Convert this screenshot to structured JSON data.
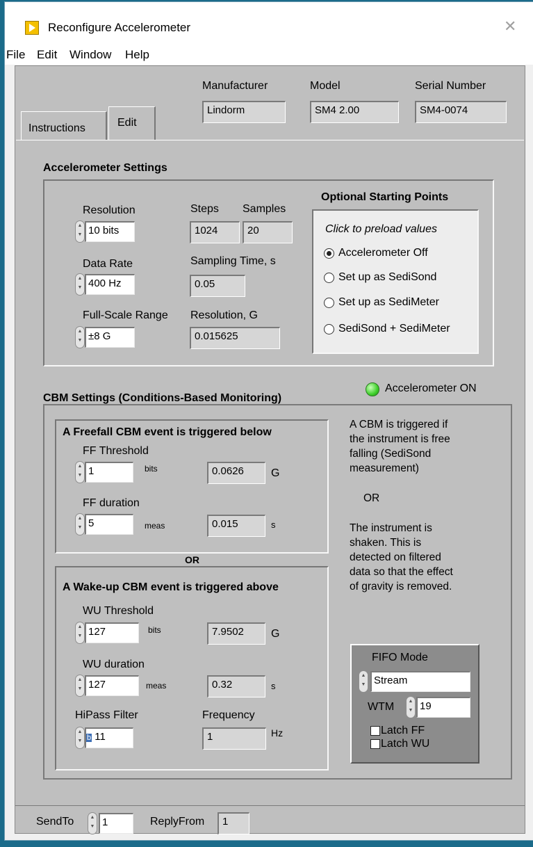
{
  "window": {
    "title": "Reconfigure Accelerometer",
    "close_glyph": "✕"
  },
  "menu": [
    "File",
    "Edit",
    "Window",
    "Help"
  ],
  "header": {
    "manufacturer_label": "Manufacturer",
    "manufacturer_value": "Lindorm",
    "model_label": "Model",
    "model_value": "SM4 2.00",
    "serial_label": "Serial Number",
    "serial_value": "SM4-0074"
  },
  "tabs": [
    {
      "label": "Instructions",
      "selected": false
    },
    {
      "label": "Edit",
      "selected": true
    }
  ],
  "accel": {
    "heading": "Accelerometer Settings",
    "resolution_label": "Resolution",
    "resolution_value": "10 bits",
    "steps_label": "Steps",
    "steps_value": "1024",
    "samples_label": "Samples",
    "samples_value": "20",
    "data_rate_label": "Data Rate",
    "data_rate_value": "400 Hz",
    "sampling_time_label": "Sampling Time, s",
    "sampling_time_value": "0.05",
    "fsr_label": "Full-Scale Range",
    "fsr_value": "±8 G",
    "res_g_label": "Resolution, G",
    "res_g_value": "0.015625"
  },
  "optional": {
    "heading": "Optional Starting Points",
    "hint": "Click to preload values",
    "options": [
      {
        "label": "Accelerometer Off",
        "selected": true
      },
      {
        "label": "Set up as SediSond",
        "selected": false
      },
      {
        "label": "Set up as SediMeter",
        "selected": false
      },
      {
        "label": "SediSond + SediMeter",
        "selected": false
      }
    ]
  },
  "cbm": {
    "heading": "CBM Settings (Conditions-Based Monitoring)",
    "led_label": "Accelerometer ON",
    "led_color": "#3ecf2a",
    "freefall": {
      "heading": "A Freefall CBM event is triggered below",
      "threshold_label": "FF Threshold",
      "threshold_value": "1",
      "threshold_unit": "bits",
      "threshold_g": "0.0626",
      "g_unit": "G",
      "duration_label": "FF duration",
      "duration_value": "5",
      "duration_unit": "meas",
      "duration_s": "0.015",
      "s_unit": "s"
    },
    "or_label": "OR",
    "wakeup": {
      "heading": "A Wake-up CBM event is triggered above",
      "threshold_label": "WU Threshold",
      "threshold_value": "127",
      "threshold_unit": "bits",
      "threshold_g": "7.9502",
      "g_unit": "G",
      "duration_label": "WU duration",
      "duration_value": "127",
      "duration_unit": "meas",
      "duration_s": "0.32",
      "s_unit": "s",
      "hipass_label": "HiPass Filter",
      "hipass_radix": "b",
      "hipass_value": "11",
      "frequency_label": "Frequency",
      "frequency_value": "1",
      "frequency_unit": "Hz"
    },
    "explanation_lines_1": [
      "A CBM is triggered if",
      "the instrument is free",
      "falling (SediSond",
      "measurement)"
    ],
    "explanation_or": "OR",
    "explanation_lines_2": [
      "The instrument is",
      "shaken. This is",
      "detected on filtered",
      "data so that the effect",
      "of gravity is removed."
    ]
  },
  "fifo": {
    "mode_label": "FIFO Mode",
    "mode_value": "Stream",
    "wtm_label": "WTM",
    "wtm_value": "19",
    "latch_ff_label": "Latch FF",
    "latch_ff_checked": false,
    "latch_wu_label": "Latch WU",
    "latch_wu_checked": false
  },
  "footer": {
    "sendto_label": "SendTo",
    "sendto_value": "1",
    "replyfrom_label": "ReplyFrom",
    "replyfrom_value": "1"
  }
}
